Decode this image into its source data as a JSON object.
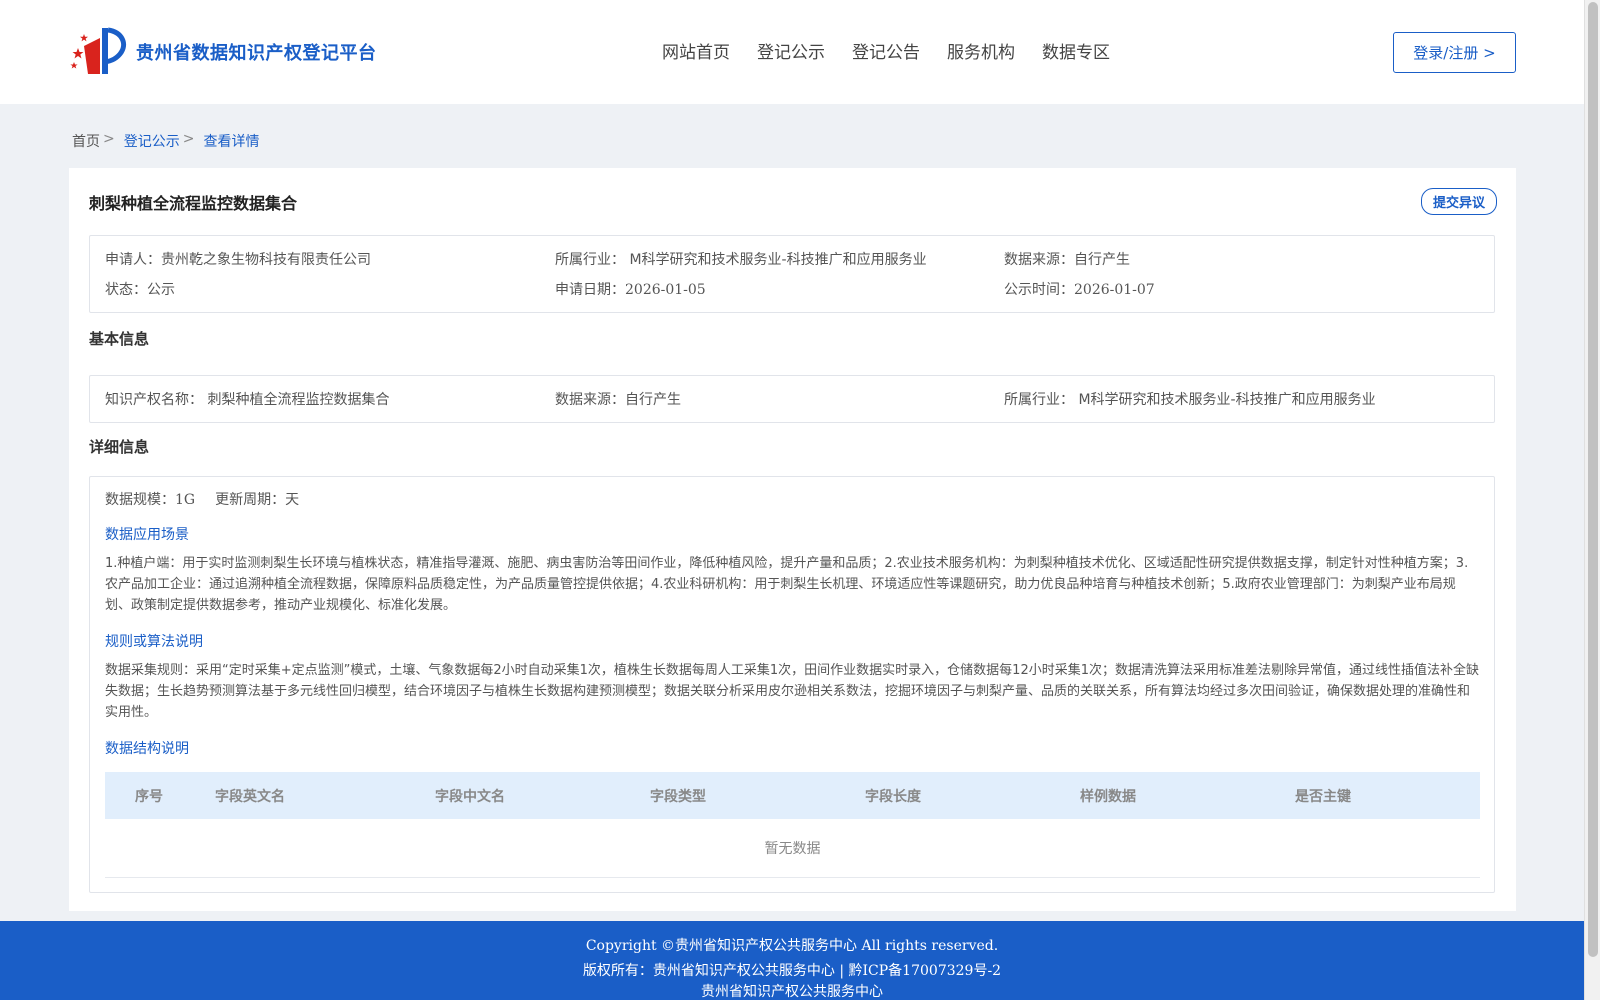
{
  "header": {
    "site_title": "贵州省数据知识产权登记平台",
    "nav": [
      "网站首页",
      "登记公示",
      "登记公告",
      "服务机构",
      "数据专区"
    ],
    "login_label": "登录/注册 >"
  },
  "breadcrumb": {
    "home": "首页",
    "sep": ">",
    "items": [
      "登记公示",
      "查看详情"
    ]
  },
  "record": {
    "title": "刺梨种植全流程监控数据集合",
    "objection_label": "提交异议",
    "summary": {
      "applicant_label": "申请人：",
      "applicant": "贵州乾之象生物科技有限责任公司",
      "industry_label": "所属行业：",
      "industry": "M科学研究和技术服务业-科技推广和应用服务业",
      "source_label": "数据来源：",
      "source": "自行产生",
      "status_label": "状态：",
      "status": "公示",
      "apply_date_label": "申请日期：",
      "apply_date": "2026-01-05",
      "publish_time_label": "公示时间：",
      "publish_time": "2026-01-07"
    },
    "basic": {
      "section_title": "基本信息",
      "ip_name_label": "知识产权名称：",
      "ip_name": "刺梨种植全流程监控数据集合",
      "source_label": "数据来源：",
      "source": "自行产生",
      "industry_label": "所属行业：",
      "industry": "M科学研究和技术服务业-科技推广和应用服务业"
    },
    "detail": {
      "section_title": "详细信息",
      "scale_label": "数据规模：",
      "scale": "1G",
      "cycle_label": "更新周期：",
      "cycle": "天",
      "scenario_title": "数据应用场景",
      "scenario_text": "1.种植户端：用于实时监测刺梨生长环境与植株状态，精准指导灌溉、施肥、病虫害防治等田间作业，降低种植风险，提升产量和品质；2.农业技术服务机构：为刺梨种植技术优化、区域适配性研究提供数据支撑，制定针对性种植方案；3.农产品加工企业：通过追溯种植全流程数据，保障原料品质稳定性，为产品质量管控提供依据；4.农业科研机构：用于刺梨生长机理、环境适应性等课题研究，助力优良品种培育与种植技术创新；5.政府农业管理部门：为刺梨产业布局规划、政策制定提供数据参考，推动产业规模化、标准化发展。",
      "rules_title": "规则或算法说明",
      "rules_text": "数据采集规则：采用“定时采集+定点监测”模式，土壤、气象数据每2小时自动采集1次，植株生长数据每周人工采集1次，田间作业数据实时录入，仓储数据每12小时采集1次；数据清洗算法采用标准差法剔除异常值，通过线性插值法补全缺失数据；生长趋势预测算法基于多元线性回归模型，结合环境因子与植株生长数据构建预测模型；数据关联分析采用皮尔逊相关系数法，挖掘环境因子与刺梨产量、品质的关联关系，所有算法均经过多次田间验证，确保数据处理的准确性和实用性。",
      "structure_title": "数据结构说明",
      "table_headers": [
        "序号",
        "字段英文名",
        "字段中文名",
        "字段类型",
        "字段长度",
        "样例数据",
        "是否主键"
      ],
      "empty_text": "暂无数据"
    }
  },
  "footer": {
    "copyright": "Copyright ©贵州省知识产权公共服务中心 All rights reserved.",
    "rights": "版权所有：贵州省知识产权公共服务中心 | 黔ICP备17007329号-2",
    "org": "贵州省知识产权公共服务中心"
  },
  "colors": {
    "brand": "#1a5ec7",
    "table_head_bg": "#e1eefc",
    "page_bg": "#eef1f5"
  }
}
